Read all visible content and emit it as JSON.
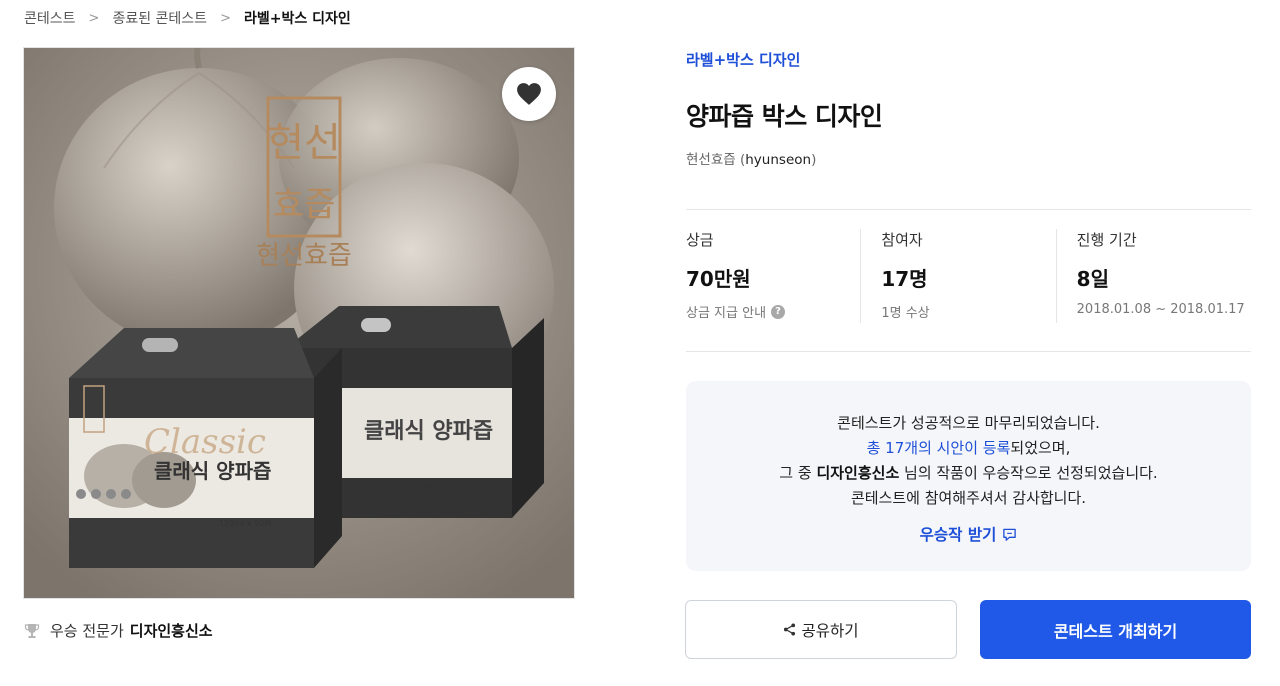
{
  "breadcrumb": {
    "items": [
      "콘테스트",
      "종료된 콘테스트",
      "라벨+박스 디자인"
    ]
  },
  "contest": {
    "category": "라벨+박스 디자인",
    "title": "양파즙 박스 디자인",
    "host_name": "현선효즙",
    "host_id": "hyunseon"
  },
  "product_image": {
    "brand_text": "현선효즙",
    "box_label": "클래식 양파즙",
    "box_sub": "120ml x 50팩",
    "script_text": "Classic"
  },
  "stats": {
    "prize": {
      "label": "상금",
      "value": "70만원",
      "sub": "상금 지급 안내"
    },
    "participants": {
      "label": "참여자",
      "value": "17명",
      "sub": "1명 수상"
    },
    "period": {
      "label": "진행 기간",
      "value": "8일",
      "sub": "2018.01.08 ~ 2018.01.17"
    }
  },
  "notice": {
    "line1": "콘테스트가 성공적으로 마무리되었습니다.",
    "line2_link": "총 17개의 시안이 등록",
    "line2_rest": "되었으며,",
    "line3_pre": "그 중 ",
    "line3_bold": "디자인흥신소",
    "line3_rest": " 님의 작품이 우승작으로 선정되었습니다.",
    "line4": "콘테스트에 참여해주셔서 감사합니다.",
    "receive_label": "우승작 받기"
  },
  "winner": {
    "label": "우승 전문가",
    "name": "디자인흥신소"
  },
  "buttons": {
    "share": "공유하기",
    "host": "콘테스트 개최하기"
  },
  "colors": {
    "accent": "#2059e8",
    "link": "#1e4fd8",
    "notice_bg": "#f4f6f9"
  }
}
